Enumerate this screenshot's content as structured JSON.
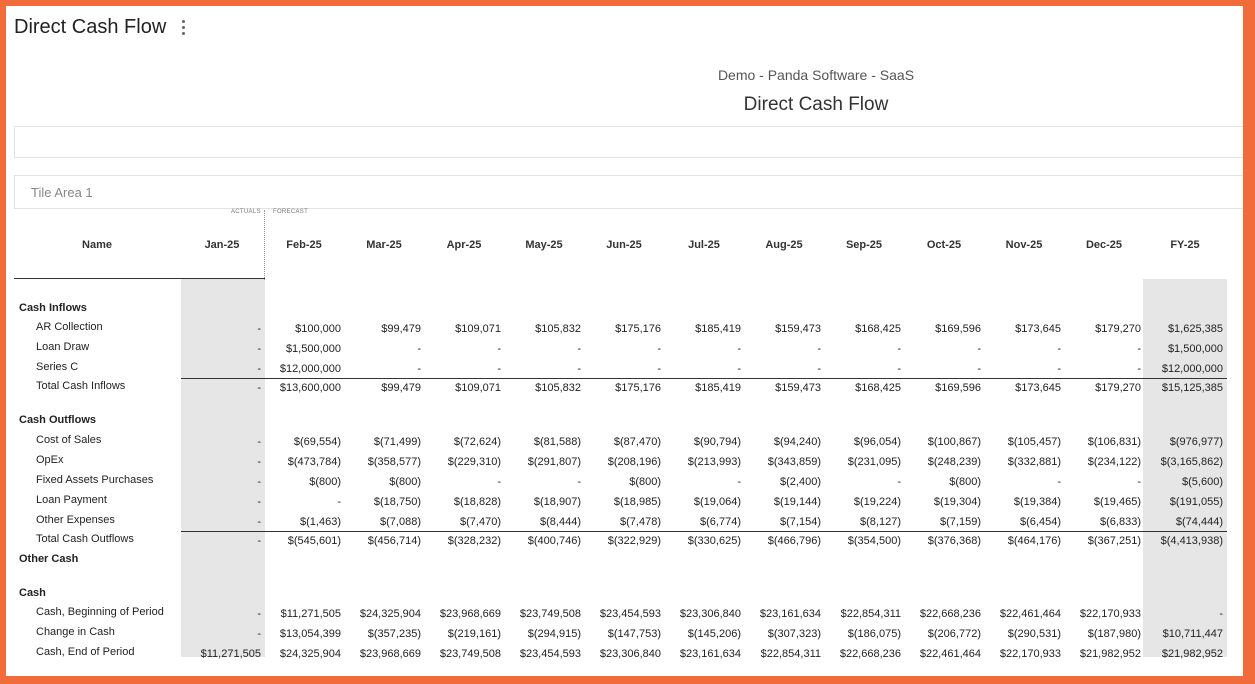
{
  "page": {
    "title": "Direct Cash Flow",
    "menu_icon": "kebab-menu-icon"
  },
  "report": {
    "company": "Demo - Panda Software - SaaS",
    "title": "Direct Cash Flow"
  },
  "tile_area": {
    "label": "Tile Area 1"
  },
  "table": {
    "actuals_label": "ACTUALS",
    "forecast_label": "FORECAST",
    "name_header": "Name",
    "columns": [
      "Jan-25",
      "Feb-25",
      "Mar-25",
      "Apr-25",
      "May-25",
      "Jun-25",
      "Jul-25",
      "Aug-25",
      "Sep-25",
      "Oct-25",
      "Nov-25",
      "Dec-25",
      "FY-25"
    ],
    "rows": [
      {
        "label": "Cash Inflows",
        "kind": "section",
        "values": []
      },
      {
        "label": "AR Collection",
        "kind": "item",
        "values": [
          "-",
          "$100,000",
          "$99,479",
          "$109,071",
          "$105,832",
          "$175,176",
          "$185,419",
          "$159,473",
          "$168,425",
          "$169,596",
          "$173,645",
          "$179,270",
          "$1,625,385"
        ]
      },
      {
        "label": "Loan Draw",
        "kind": "item",
        "values": [
          "-",
          "$1,500,000",
          "-",
          "-",
          "-",
          "-",
          "-",
          "-",
          "-",
          "-",
          "-",
          "-",
          "$1,500,000"
        ]
      },
      {
        "label": "Series C",
        "kind": "item",
        "values": [
          "-",
          "$12,000,000",
          "-",
          "-",
          "-",
          "-",
          "-",
          "-",
          "-",
          "-",
          "-",
          "-",
          "$12,000,000"
        ]
      },
      {
        "label": "Total Cash Inflows",
        "kind": "total",
        "values": [
          "-",
          "$13,600,000",
          "$99,479",
          "$109,071",
          "$105,832",
          "$175,176",
          "$185,419",
          "$159,473",
          "$168,425",
          "$169,596",
          "$173,645",
          "$179,270",
          "$15,125,385"
        ]
      },
      {
        "label": "Cash Outflows",
        "kind": "section",
        "values": []
      },
      {
        "label": "Cost of Sales",
        "kind": "item",
        "values": [
          "-",
          "$(69,554)",
          "$(71,499)",
          "$(72,624)",
          "$(81,588)",
          "$(87,470)",
          "$(90,794)",
          "$(94,240)",
          "$(96,054)",
          "$(100,867)",
          "$(105,457)",
          "$(106,831)",
          "$(976,977)"
        ]
      },
      {
        "label": "OpEx",
        "kind": "item",
        "values": [
          "-",
          "$(473,784)",
          "$(358,577)",
          "$(229,310)",
          "$(291,807)",
          "$(208,196)",
          "$(213,993)",
          "$(343,859)",
          "$(231,095)",
          "$(248,239)",
          "$(332,881)",
          "$(234,122)",
          "$(3,165,862)"
        ]
      },
      {
        "label": "Fixed Assets Purchases",
        "kind": "item",
        "values": [
          "-",
          "$(800)",
          "$(800)",
          "-",
          "-",
          "$(800)",
          "-",
          "$(2,400)",
          "-",
          "$(800)",
          "-",
          "-",
          "$(5,600)"
        ]
      },
      {
        "label": "Loan Payment",
        "kind": "item",
        "values": [
          "-",
          "-",
          "$(18,750)",
          "$(18,828)",
          "$(18,907)",
          "$(18,985)",
          "$(19,064)",
          "$(19,144)",
          "$(19,224)",
          "$(19,304)",
          "$(19,384)",
          "$(19,465)",
          "$(191,055)"
        ]
      },
      {
        "label": "Other Expenses",
        "kind": "item",
        "values": [
          "-",
          "$(1,463)",
          "$(7,088)",
          "$(7,470)",
          "$(8,444)",
          "$(7,478)",
          "$(6,774)",
          "$(7,154)",
          "$(8,127)",
          "$(7,159)",
          "$(6,454)",
          "$(6,833)",
          "$(74,444)"
        ]
      },
      {
        "label": "Total Cash Outflows",
        "kind": "total",
        "values": [
          "-",
          "$(545,601)",
          "$(456,714)",
          "$(328,232)",
          "$(400,746)",
          "$(322,929)",
          "$(330,625)",
          "$(466,796)",
          "$(354,500)",
          "$(376,368)",
          "$(464,176)",
          "$(367,251)",
          "$(4,413,938)"
        ]
      },
      {
        "label": "Other Cash",
        "kind": "section",
        "values": []
      },
      {
        "label": "Cash",
        "kind": "section",
        "values": []
      },
      {
        "label": "Cash, Beginning of Period",
        "kind": "item",
        "values": [
          "-",
          "$11,271,505",
          "$24,325,904",
          "$23,968,669",
          "$23,749,508",
          "$23,454,593",
          "$23,306,840",
          "$23,161,634",
          "$22,854,311",
          "$22,668,236",
          "$22,461,464",
          "$22,170,933",
          "-"
        ]
      },
      {
        "label": "Change in Cash",
        "kind": "item",
        "values": [
          "-",
          "$13,054,399",
          "$(357,235)",
          "$(219,161)",
          "$(294,915)",
          "$(147,753)",
          "$(145,206)",
          "$(307,323)",
          "$(186,075)",
          "$(206,772)",
          "$(290,531)",
          "$(187,980)",
          "$10,711,447"
        ]
      },
      {
        "label": "Cash, End of Period",
        "kind": "item",
        "values": [
          "$11,271,505",
          "$24,325,904",
          "$23,968,669",
          "$23,749,508",
          "$23,454,593",
          "$23,306,840",
          "$23,161,634",
          "$22,854,311",
          "$22,668,236",
          "$22,461,464",
          "$22,170,933",
          "$21,982,952",
          "$21,982,952"
        ]
      }
    ]
  }
}
